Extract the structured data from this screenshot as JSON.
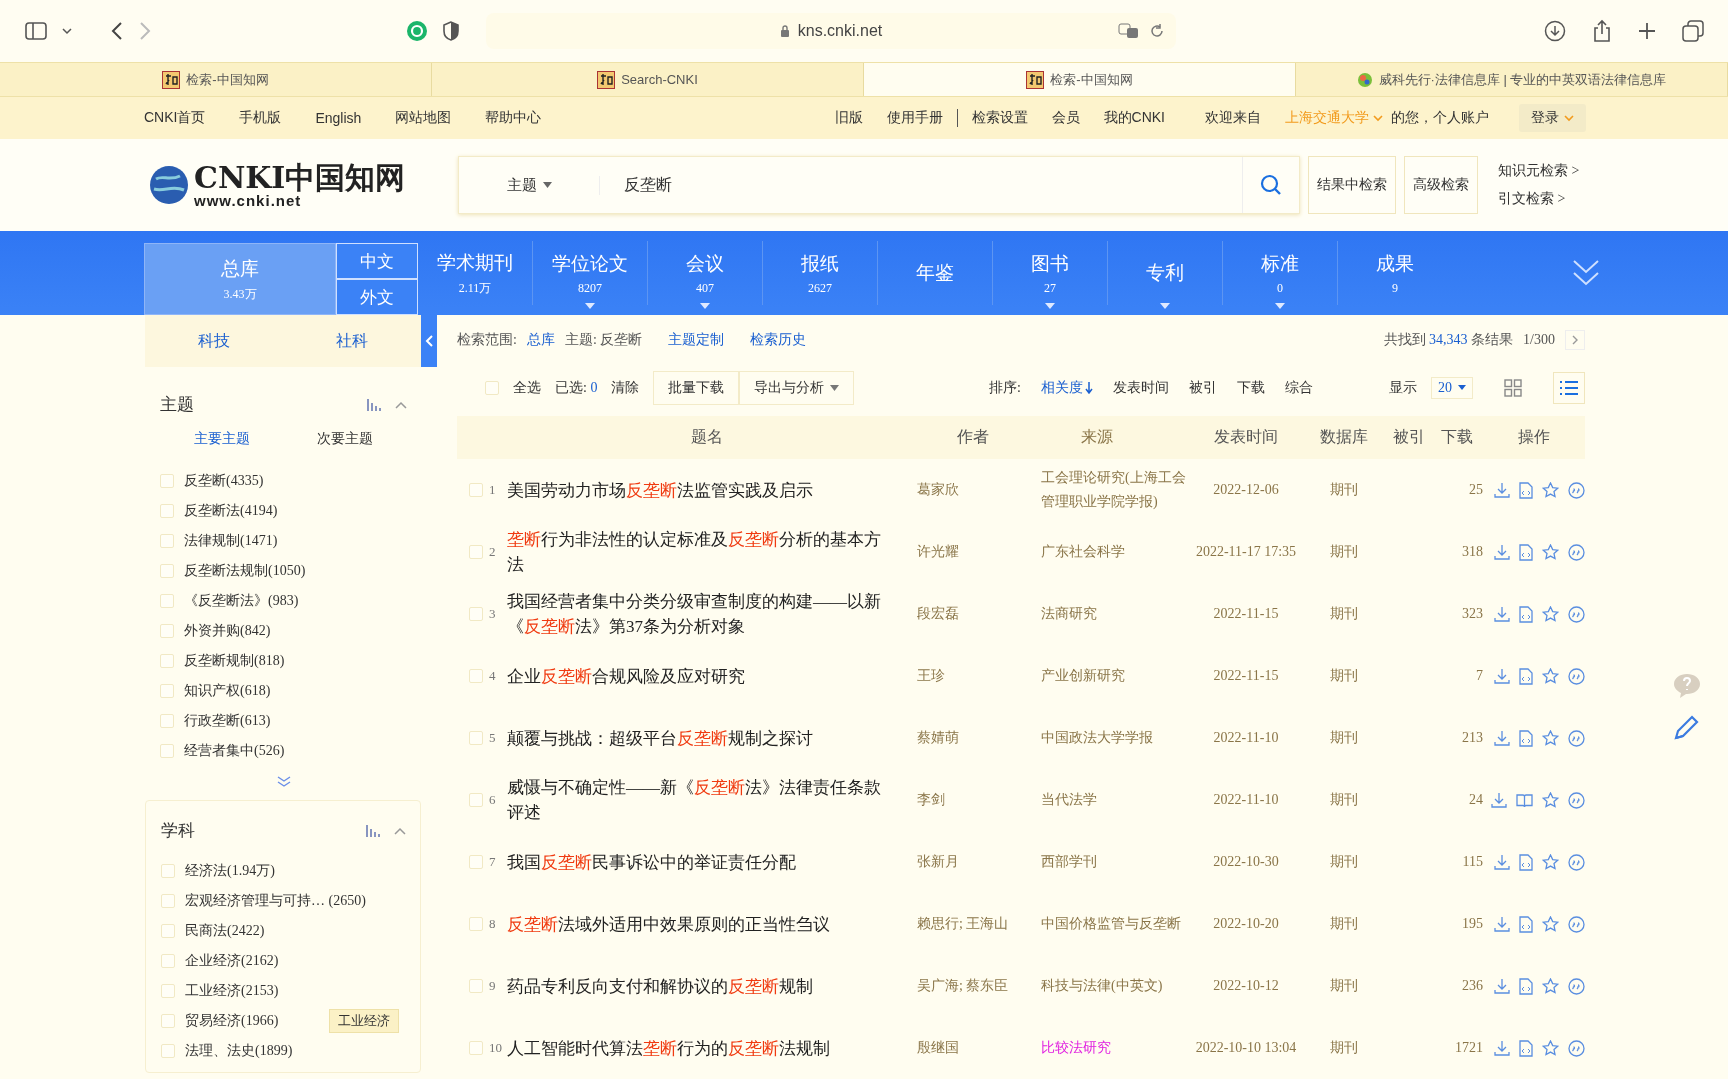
{
  "browser": {
    "url": "kns.cnki.net",
    "tabs": [
      {
        "title": "检索-中国知网",
        "kind": "cnki",
        "selected": false
      },
      {
        "title": "Search-CNKI",
        "kind": "cnki",
        "selected": false
      },
      {
        "title": "检索-中国知网",
        "kind": "cnki",
        "selected": true
      },
      {
        "title": "威科先行·法律信息库 | 专业的中英双语法律信息库",
        "kind": "globe",
        "selected": false
      }
    ]
  },
  "topnav": {
    "left": [
      "CNKI首页",
      "手机版",
      "English",
      "网站地图",
      "帮助中心"
    ],
    "right": [
      "旧版",
      "使用手册",
      "检索设置",
      "会员",
      "我的CNKI"
    ],
    "welcome": "欢迎来自",
    "institution": "上海交通大学",
    "account": "的您，个人账户",
    "login": "登录"
  },
  "search": {
    "logo": "CNKI中国知网",
    "logo_url": "www.cnki.net",
    "field": "主题",
    "query": "反垄断",
    "buttons": [
      "结果中检索",
      "高级检索"
    ],
    "links": [
      "知识元检索 >",
      "引文检索 >"
    ]
  },
  "databases": {
    "total": {
      "name": "总库",
      "count": "3.43万",
      "selected": true,
      "langs": [
        "中文",
        "外文"
      ]
    },
    "items": [
      {
        "name": "学术期刊",
        "count": "2.11万",
        "caret": false
      },
      {
        "name": "学位论文",
        "count": "8207",
        "caret": true
      },
      {
        "name": "会议",
        "count": "407",
        "caret": true
      },
      {
        "name": "报纸",
        "count": "2627",
        "caret": false
      },
      {
        "name": "年鉴",
        "caret": false
      },
      {
        "name": "图书",
        "count": "27",
        "caret": true
      },
      {
        "name": "专利",
        "caret": true
      },
      {
        "name": "标准",
        "count": "0",
        "caret": true
      },
      {
        "name": "成果",
        "count": "9",
        "caret": false
      }
    ]
  },
  "sidebar": {
    "tabs": [
      "科技",
      "社科"
    ],
    "sections": [
      {
        "title": "主题",
        "subtabs": [
          {
            "label": "主要主题",
            "selected": true
          },
          {
            "label": "次要主题",
            "selected": false
          }
        ],
        "more": true,
        "items": [
          {
            "label": "反垄断(4335)",
            "checked": false
          },
          {
            "label": "反垄断法(4194)",
            "checked": false
          },
          {
            "label": "法律规制(1471)",
            "checked": false
          },
          {
            "label": "反垄断法规制(1050)",
            "checked": false
          },
          {
            "label": "《反垄断法》(983)",
            "checked": false
          },
          {
            "label": "外资并购(842)",
            "checked": false
          },
          {
            "label": "反垄断规制(818)",
            "checked": false
          },
          {
            "label": "知识产权(618)",
            "checked": false
          },
          {
            "label": "行政垄断(613)",
            "checked": false
          },
          {
            "label": "经营者集中(526)",
            "checked": false
          }
        ]
      },
      {
        "title": "学科",
        "items": [
          {
            "label": "经济法(1.94万)",
            "checked": false
          },
          {
            "label": "宏观经济管理与可持… (2650)",
            "checked": false
          },
          {
            "label": "民商法(2422)",
            "checked": false
          },
          {
            "label": "企业经济(2162)",
            "checked": false
          },
          {
            "label": "工业经济(2153)",
            "checked": false
          },
          {
            "label": "贸易经济(1966)",
            "checked": false
          },
          {
            "label": "法理、法史(1899)",
            "checked": false
          }
        ]
      }
    ],
    "tooltip": "工业经济"
  },
  "scope": {
    "label": "检索范围:",
    "db": "总库",
    "topic": "主题: 反垄断",
    "links": [
      "主题定制",
      "检索历史"
    ],
    "found_prefix": "共找到",
    "found": "34,343",
    "found_suffix": "条结果",
    "page": "1/300"
  },
  "toolbar": {
    "select_all": "全选",
    "select_all_checked": false,
    "selected_label": "已选:",
    "selected_count": "0",
    "clear": "清除",
    "batch": "批量下载",
    "export": "导出与分析",
    "sort_label": "排序:",
    "sorts": [
      {
        "label": "相关度",
        "selected": true
      },
      {
        "label": "发表时间",
        "selected": false
      },
      {
        "label": "被引",
        "selected": false
      },
      {
        "label": "下载",
        "selected": false
      },
      {
        "label": "综合",
        "selected": false
      }
    ],
    "show_label": "显示",
    "page_size": "20",
    "views": [
      {
        "kind": "grid",
        "selected": false
      },
      {
        "kind": "list",
        "selected": true
      }
    ]
  },
  "table": {
    "columns": [
      "题名",
      "作者",
      "来源",
      "发表时间",
      "数据库",
      "被引",
      "下载",
      "操作"
    ],
    "rows": [
      {
        "n": "1",
        "checked": false,
        "title": [
          {
            "t": "美国劳动力市场",
            "hit": false
          },
          {
            "t": "反垄断",
            "hit": true
          },
          {
            "t": "法监管实践及启示",
            "hit": false
          }
        ],
        "author": "葛家欣",
        "source": "工会理论研究(上海工会管理职业学院学报)",
        "visited": false,
        "date": "2022-12-06",
        "db": "期刊",
        "downloads": "25",
        "kind": "html"
      },
      {
        "n": "2",
        "checked": false,
        "title": [
          {
            "t": "垄断",
            "hit": true
          },
          {
            "t": "行为非法性的认定标准及",
            "hit": false
          },
          {
            "t": "反垄断",
            "hit": true
          },
          {
            "t": "分析的基本方法",
            "hit": false
          }
        ],
        "author": "许光耀",
        "source": "广东社会科学",
        "visited": false,
        "date": "2022-11-17 17:35",
        "db": "期刊",
        "downloads": "318",
        "kind": "html"
      },
      {
        "n": "3",
        "checked": false,
        "title": [
          {
            "t": "我国经营者集中分类分级审查制度的构建——以新《",
            "hit": false
          },
          {
            "t": "反垄断",
            "hit": true
          },
          {
            "t": "法》第37条为分析对象",
            "hit": false
          }
        ],
        "author": "段宏磊",
        "source": "法商研究",
        "visited": false,
        "date": "2022-11-15",
        "db": "期刊",
        "downloads": "323",
        "kind": "html"
      },
      {
        "n": "4",
        "checked": false,
        "title": [
          {
            "t": "企业",
            "hit": false
          },
          {
            "t": "反垄断",
            "hit": true
          },
          {
            "t": "合规风险及应对研究",
            "hit": false
          }
        ],
        "author": "王珍",
        "source": "产业创新研究",
        "visited": false,
        "date": "2022-11-15",
        "db": "期刊",
        "downloads": "7",
        "kind": "html"
      },
      {
        "n": "5",
        "checked": false,
        "title": [
          {
            "t": "颠覆与挑战：超级平台",
            "hit": false
          },
          {
            "t": "反垄断",
            "hit": true
          },
          {
            "t": "规制之探讨",
            "hit": false
          }
        ],
        "author": "蔡婧萌",
        "source": "中国政法大学学报",
        "visited": false,
        "date": "2022-11-10",
        "db": "期刊",
        "downloads": "213",
        "kind": "html"
      },
      {
        "n": "6",
        "checked": false,
        "title": [
          {
            "t": "威慑与不确定性——新《",
            "hit": false
          },
          {
            "t": "反垄断",
            "hit": true
          },
          {
            "t": "法》法律责任条款评述",
            "hit": false
          }
        ],
        "author": "李剑",
        "source": "当代法学",
        "visited": false,
        "date": "2022-11-10",
        "db": "期刊",
        "downloads": "24",
        "kind": "book"
      },
      {
        "n": "7",
        "checked": false,
        "title": [
          {
            "t": "我国",
            "hit": false
          },
          {
            "t": "反垄断",
            "hit": true
          },
          {
            "t": "民事诉讼中的举证责任分配",
            "hit": false
          }
        ],
        "author": "张新月",
        "source": "西部学刊",
        "visited": false,
        "date": "2022-10-30",
        "db": "期刊",
        "downloads": "115",
        "kind": "html"
      },
      {
        "n": "8",
        "checked": false,
        "title": [
          {
            "t": "反垄断",
            "hit": true
          },
          {
            "t": "法域外适用中效果原则的正当性刍议",
            "hit": false
          }
        ],
        "author": "赖思行; 王海山",
        "source": "中国价格监管与反垄断",
        "visited": false,
        "date": "2022-10-20",
        "db": "期刊",
        "downloads": "195",
        "kind": "html"
      },
      {
        "n": "9",
        "checked": false,
        "title": [
          {
            "t": "药品专利反向支付和解协议的",
            "hit": false
          },
          {
            "t": "反垄断",
            "hit": true
          },
          {
            "t": "规制",
            "hit": false
          }
        ],
        "author": "吴广海; 蔡东臣",
        "source": "科技与法律(中英文)",
        "visited": false,
        "date": "2022-10-12",
        "db": "期刊",
        "downloads": "236",
        "kind": "html"
      },
      {
        "n": "10",
        "checked": false,
        "title": [
          {
            "t": "人工智能时代算法",
            "hit": false
          },
          {
            "t": "垄断",
            "hit": true
          },
          {
            "t": "行为的",
            "hit": false
          },
          {
            "t": "反垄断",
            "hit": true
          },
          {
            "t": "法规制",
            "hit": false
          }
        ],
        "author": "殷继国",
        "source": "比较法研究",
        "visited": true,
        "date": "2022-10-10 13:04",
        "db": "期刊",
        "downloads": "1721",
        "kind": "html"
      }
    ]
  }
}
